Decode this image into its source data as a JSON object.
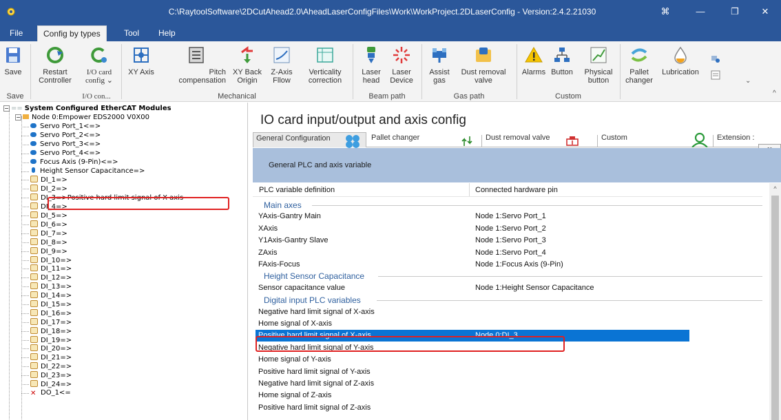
{
  "window": {
    "title": "C:\\RaytoolSoftware\\2DCutAhead2.0\\AheadLaserConfigFiles\\Work\\WorkProject.2DLaserConfig - Version:2.4.2.21030",
    "controls": [
      "⌘",
      "—",
      "❐",
      "✕"
    ]
  },
  "menu": [
    "File",
    "Config by types",
    "Tool",
    "Help"
  ],
  "ribbon": {
    "buttons": [
      "Save",
      "Restart\nController",
      "I/O card\nconfig ⌄",
      "XY Axis",
      "Pitch\ncompensation",
      "XY Back\nOrigin",
      "Z-Axis\nFllow",
      "Verticality\ncorrection",
      "Laser\nhead",
      "Laser\nDevice",
      "Assist\ngas",
      "Dust removal\nvalve",
      "Alarms",
      "Button",
      "Physical\nbutton",
      "Pallet\nchanger",
      "Lubrication"
    ],
    "groups": [
      "Save",
      "I/O con...",
      "Mechanical",
      "Beam path",
      "Gas path",
      "Custom"
    ]
  },
  "tree": {
    "root": "System Configured EtherCAT Modules",
    "node": "Node 0:Empower EDS2000 V0X00",
    "axes": [
      "Servo Port_1<=>",
      "Servo Port_2<=>",
      "Servo Port_3<=>",
      "Servo Port_4<=>",
      "Focus Axis (9-Pin)<=>",
      "Height Sensor Capacitance=>"
    ],
    "di": [
      "DI_1=>",
      "DI_2=>",
      "DI_3=>Positive hard limit signal of X-axis",
      "DI_4=>",
      "DI_5=>",
      "DI_6=>",
      "DI_7=>",
      "DI_8=>",
      "DI_9=>",
      "DI_10=>",
      "DI_11=>",
      "DI_12=>",
      "DI_13=>",
      "DI_14=>",
      "DI_15=>",
      "DI_16=>",
      "DI_17=>",
      "DI_18=>",
      "DI_19=>",
      "DI_20=>",
      "DI_21=>",
      "DI_22=>",
      "DI_23=>",
      "DI_24=>"
    ],
    "do": [
      "DO_1<="
    ]
  },
  "panel": {
    "title": "IO card input/output and axis config",
    "tabs": [
      "General Configuration",
      "Pallet changer",
      "Dust removal valve",
      "Custom",
      "Extension :"
    ],
    "subheader": "General PLC and axis variable",
    "columns": [
      "PLC variable definition",
      "Connected hardware pin"
    ],
    "sections": [
      "Main axes",
      "Height Sensor Capacitance",
      "Digital input PLC variables"
    ],
    "main_axes": [
      {
        "name": "YAxis-Gantry Main",
        "pin": "Node 1:Servo Port_1"
      },
      {
        "name": "XAxis",
        "pin": "Node 1:Servo Port_2"
      },
      {
        "name": "Y1Axis-Gantry Slave",
        "pin": "Node 1:Servo Port_3"
      },
      {
        "name": "ZAxis",
        "pin": "Node 1:Servo Port_4"
      },
      {
        "name": "FAxis-Focus",
        "pin": "Node 1:Focus Axis (9-Pin)"
      }
    ],
    "height_sensor": [
      {
        "name": "Sensor capacitance value",
        "pin": "Node 1:Height Sensor Capacitance"
      }
    ],
    "digital_inputs": [
      {
        "name": "Negative hard limit signal of X-axis",
        "pin": ""
      },
      {
        "name": "Home signal of X-axis",
        "pin": ""
      },
      {
        "name": "Positive hard limit signal of X-axis",
        "pin": "Node 0:DI_3"
      },
      {
        "name": "Negative hard limit signal of Y-axis",
        "pin": ""
      },
      {
        "name": "Home signal of Y-axis",
        "pin": ""
      },
      {
        "name": "Positive hard limit signal of Y-axis",
        "pin": ""
      },
      {
        "name": "Negative hard limit signal of Z-axis",
        "pin": ""
      },
      {
        "name": "Home signal of Z-axis",
        "pin": ""
      },
      {
        "name": "Positive hard limit signal of Z-axis",
        "pin": ""
      }
    ]
  },
  "colors": {
    "titlebar": "#2b579a",
    "selection": "#0a74d4",
    "highlight_box": "#e02020",
    "subheader": "#a9bfdc"
  }
}
